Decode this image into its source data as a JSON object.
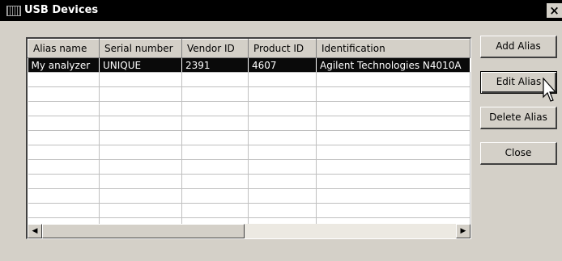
{
  "window": {
    "title": "USB Devices",
    "close_glyph": "×"
  },
  "list": {
    "columns": [
      "Alias name",
      "Serial number",
      "Vendor ID",
      "Product ID",
      "Identification"
    ],
    "rows": [
      {
        "alias": "My analyzer",
        "serial": "UNIQUE",
        "vendor": "2391",
        "product": "4607",
        "identification": "Agilent Technologies N4010A"
      }
    ],
    "selected_row": 0
  },
  "buttons": {
    "add_alias": "Add Alias",
    "edit_alias": "Edit Alias",
    "delete_alias": "Delete Alias",
    "close": "Close"
  },
  "scrollbar": {
    "left_arrow": "◀",
    "right_arrow": "▶"
  },
  "colors": {
    "selection": "#0a0a0a",
    "face": "#d4d0c8",
    "titlebar": "#000000"
  }
}
